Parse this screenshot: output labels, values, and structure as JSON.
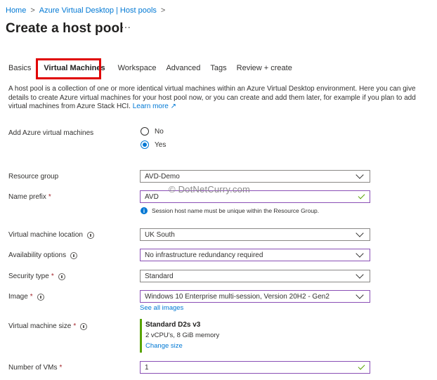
{
  "breadcrumb": {
    "items": [
      "Home",
      "Azure Virtual Desktop | Host pools"
    ],
    "separator": ">"
  },
  "page": {
    "title": "Create a host pool",
    "more": "···"
  },
  "tabs": [
    {
      "label": "Basics",
      "active": false
    },
    {
      "label": "Virtual Machines",
      "active": true
    },
    {
      "label": "Workspace",
      "active": false
    },
    {
      "label": "Advanced",
      "active": false
    },
    {
      "label": "Tags",
      "active": false
    },
    {
      "label": "Review + create",
      "active": false
    }
  ],
  "description": {
    "text": "A host pool is a collection of one or more identical virtual machines within an Azure Virtual Desktop environment. Here you can give details to create Azure virtual machines for your host pool now, or you can create and add them later, for example if you plan to add virtual machines from Azure Stack HCI.",
    "link": "Learn more ↗"
  },
  "form": {
    "add_vms": {
      "label": "Add Azure virtual machines",
      "options": [
        "No",
        "Yes"
      ],
      "selected": "Yes"
    },
    "resource_group": {
      "label": "Resource group",
      "value": "AVD-Demo"
    },
    "name_prefix": {
      "label": "Name prefix",
      "required": "*",
      "value": "AVD",
      "note": "Session host name must be unique within the Resource Group."
    },
    "vm_location": {
      "label": "Virtual machine location",
      "value": "UK South"
    },
    "availability": {
      "label": "Availability options",
      "value": "No infrastructure redundancy required"
    },
    "security_type": {
      "label": "Security type",
      "required": "*",
      "value": "Standard"
    },
    "image": {
      "label": "Image",
      "required": "*",
      "value": "Windows 10 Enterprise multi-session, Version 20H2 - Gen2",
      "link": "See all images"
    },
    "vm_size": {
      "label": "Virtual machine size",
      "required": "*",
      "name": "Standard D2s v3",
      "spec": "2 vCPU's, 8 GiB memory",
      "link": "Change size"
    },
    "num_vms": {
      "label": "Number of VMs",
      "required": "*",
      "value": "1"
    }
  },
  "watermark": "© DotNetCurry.com",
  "colors": {
    "accent": "#0078d4",
    "highlight_box": "#e00000",
    "valid": "#57a300",
    "purple_border": "#8a4fb5"
  }
}
